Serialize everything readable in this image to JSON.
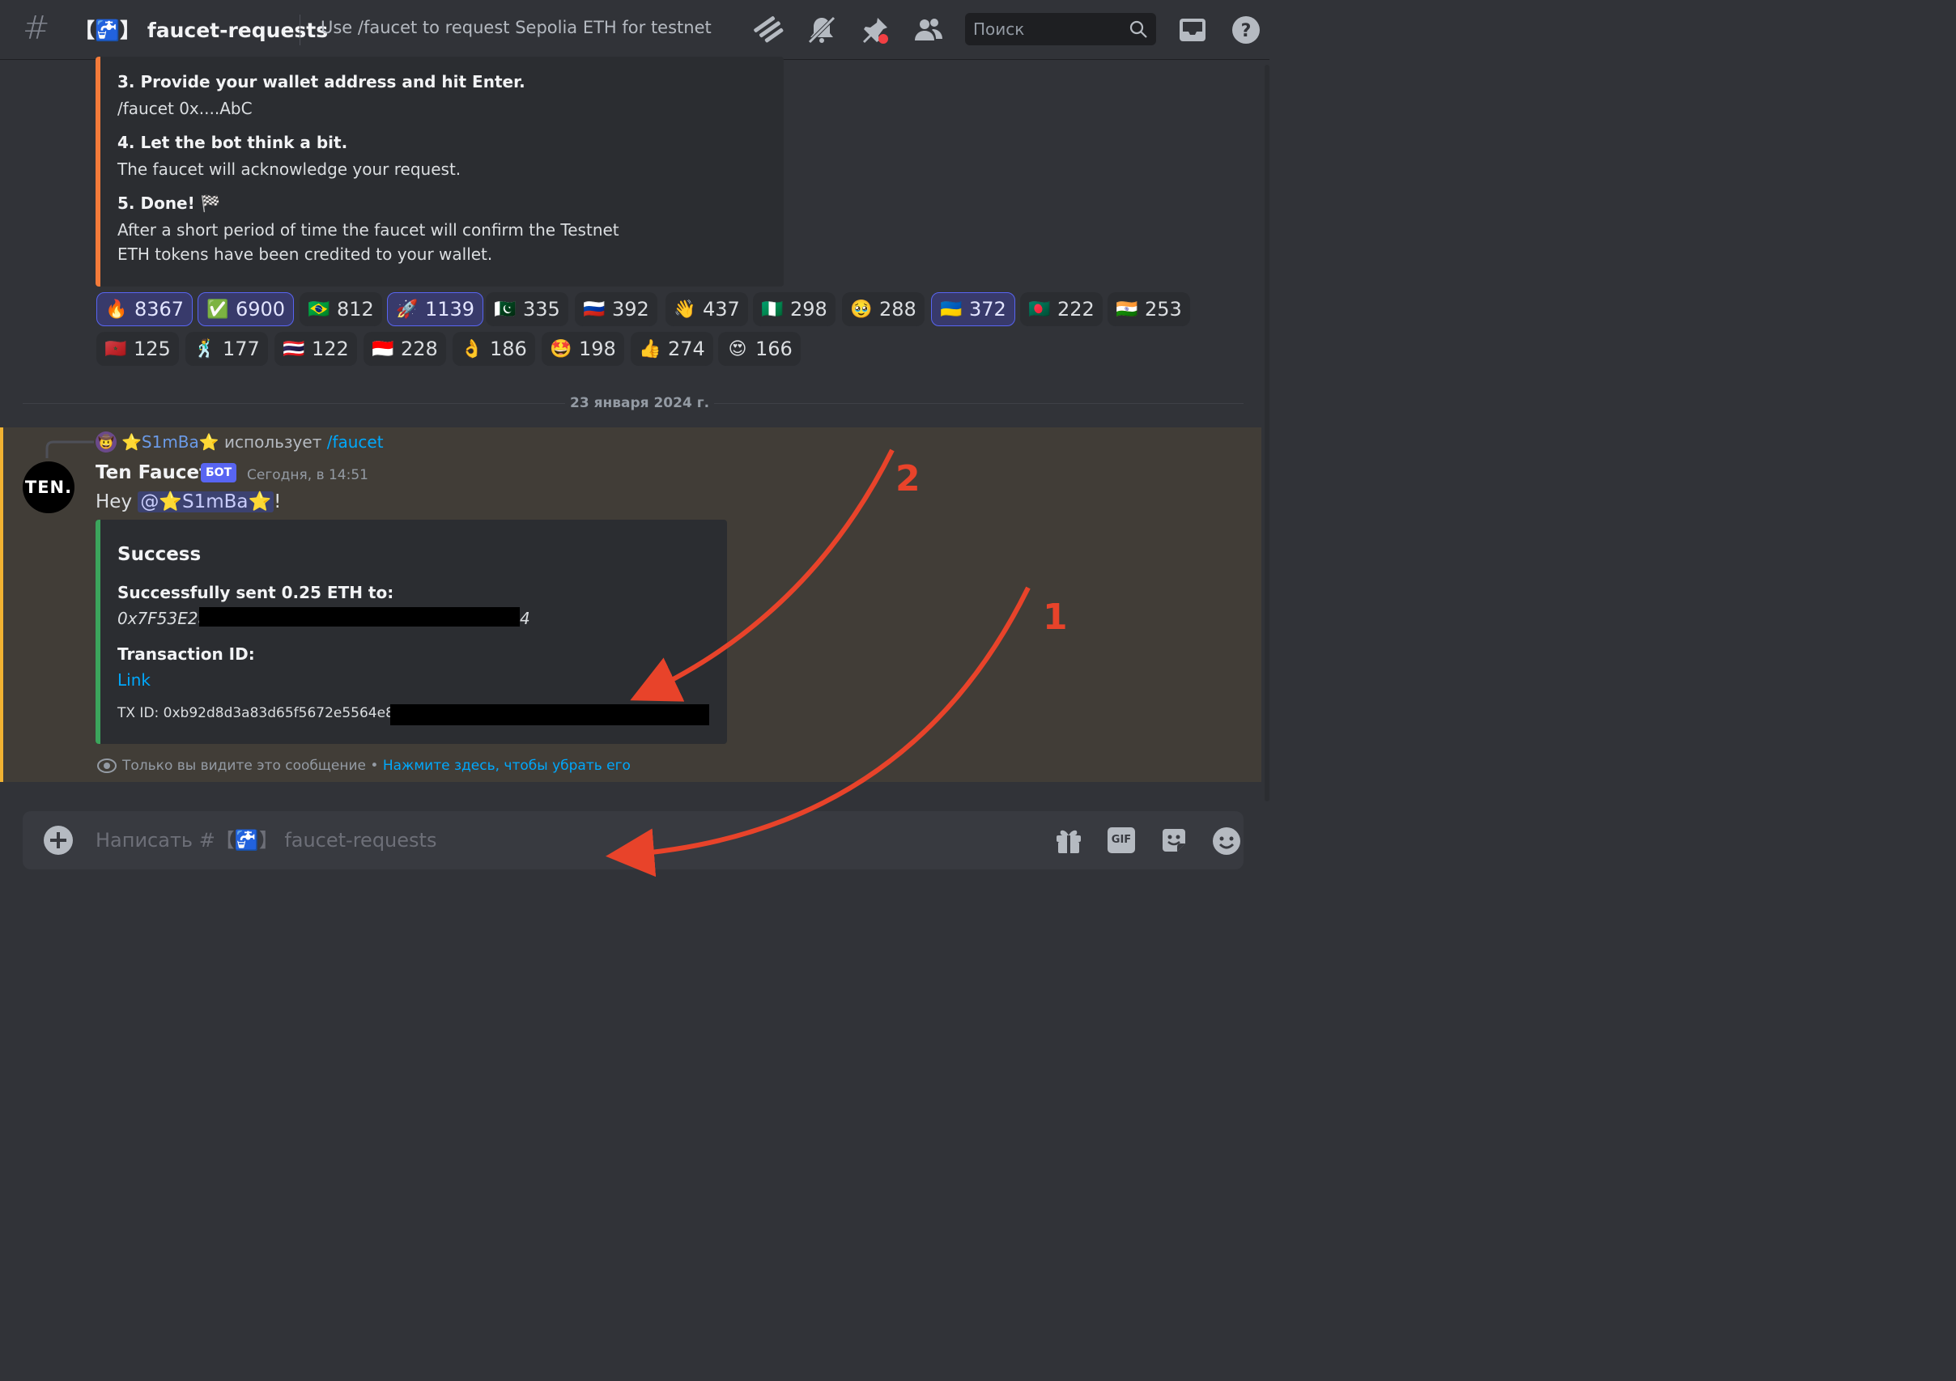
{
  "header": {
    "channel_name": "【🚰】 faucet-requests",
    "topic": "Use /faucet to request Sepolia ETH for testnet",
    "search_placeholder": "Поиск",
    "icons": [
      "threads-icon",
      "mute-bell-icon",
      "pin-icon",
      "members-icon",
      "inbox-icon",
      "help-icon"
    ]
  },
  "instructions": {
    "step3_title": "3. Provide your wallet address and hit Enter.",
    "step3_body": "/faucet 0x....AbC",
    "step4_title": "4. Let the bot think a bit.",
    "step4_body": "The faucet will acknowledge your request.",
    "step5_title": "5. Done! 🏁",
    "step5_body_line1": "After a short period of time the faucet will confirm the Testnet",
    "step5_body_line2": "ETH tokens have been credited to your wallet.",
    "accent_color": "#f47b3a"
  },
  "reactions": [
    {
      "emoji": "🔥",
      "count": "8367",
      "active": true
    },
    {
      "emoji": "✅",
      "count": "6900",
      "active": true
    },
    {
      "emoji": "🇧🇷",
      "count": "812",
      "active": false
    },
    {
      "emoji": "🚀",
      "count": "1139",
      "active": true
    },
    {
      "emoji": "🇵🇰",
      "count": "335",
      "active": false
    },
    {
      "emoji": "🇷🇺",
      "count": "392",
      "active": false
    },
    {
      "emoji": "👋",
      "count": "437",
      "active": false
    },
    {
      "emoji": "🇳🇬",
      "count": "298",
      "active": false
    },
    {
      "emoji": "🥹",
      "count": "288",
      "active": false
    },
    {
      "emoji": "🇺🇦",
      "count": "372",
      "active": true
    },
    {
      "emoji": "🇧🇩",
      "count": "222",
      "active": false
    },
    {
      "emoji": "🇮🇳",
      "count": "253",
      "active": false
    },
    {
      "emoji": "🇲🇦",
      "count": "125",
      "active": false
    },
    {
      "emoji": "🕺",
      "count": "177",
      "active": false
    },
    {
      "emoji": "🇹🇭",
      "count": "122",
      "active": false
    },
    {
      "emoji": "🇮🇩",
      "count": "228",
      "active": false
    },
    {
      "emoji": "👌",
      "count": "186",
      "active": false
    },
    {
      "emoji": "🤩",
      "count": "198",
      "active": false
    },
    {
      "emoji": "👍",
      "count": "274",
      "active": false
    },
    {
      "emoji": "😍",
      "count": "166",
      "active": false
    }
  ],
  "date_separator": "23 января 2024 г.",
  "message": {
    "reply_user": "⭐S1mBa⭐",
    "reply_action": "использует",
    "reply_command": "/faucet",
    "author": "Ten Faucet",
    "bot_badge": "БОТ",
    "timestamp": "Сегодня, в 14:51",
    "avatar_text": "TEN.",
    "text_prefix": "Hey",
    "mention": "@⭐S1mBa⭐",
    "text_suffix": "!",
    "embed": {
      "title": "Success",
      "sent_label": "Successfully sent 0.25 ETH to:",
      "address_start": "0x7F53E2a",
      "address_end": "4",
      "txid_label": "Transaction ID:",
      "link_text": "Link",
      "txid_text": "TX ID: 0xb92d8d3a83d65f5672e5564e8",
      "accent_color": "#3ba55c"
    },
    "ephemeral_note": "Только вы видите это сообщение •",
    "ephemeral_dismiss": "Нажмите здесь, чтобы убрать его"
  },
  "composer": {
    "placeholder": "Написать #【🚰】 faucet-requests",
    "gif_label": "GIF"
  },
  "annotations": {
    "arrow1_label": "1",
    "arrow2_label": "2",
    "color": "#e8432a"
  }
}
